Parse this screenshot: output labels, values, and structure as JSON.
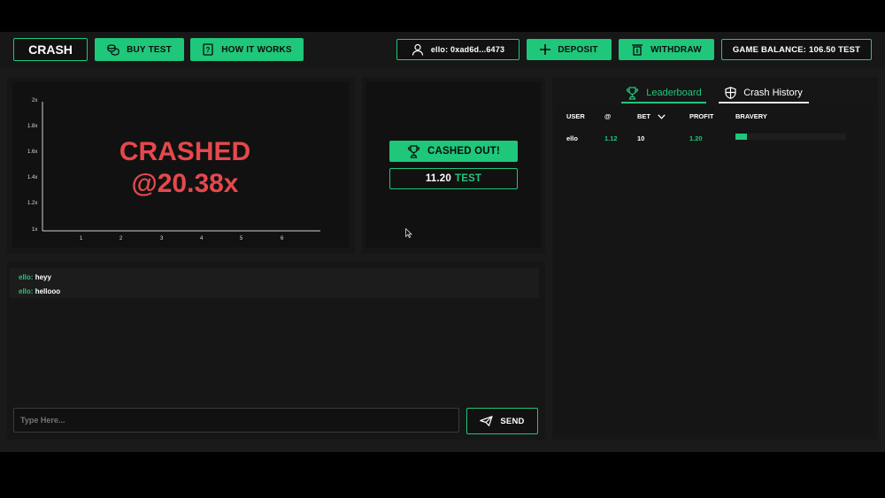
{
  "header": {
    "logo": "CRASH",
    "buy_label": "BUY TEST",
    "how_label": "HOW IT WORKS",
    "account_label": "ello: 0xad6d...6473",
    "deposit_label": "DEPOSIT",
    "withdraw_label": "WITHDRAW",
    "balance_label": "GAME BALANCE: 106.50 TEST"
  },
  "game": {
    "status_line1": "CRASHED",
    "status_line2": "@20.38x",
    "y_ticks": [
      "2x",
      "1.8x",
      "1.6x",
      "1.4x",
      "1.2x",
      "1x"
    ],
    "x_ticks": [
      "1",
      "2",
      "3",
      "4",
      "5",
      "6"
    ]
  },
  "bet": {
    "cashed_out_label": "CASHED OUT!",
    "amount": "11.20",
    "currency": "TEST"
  },
  "chat": {
    "messages": [
      {
        "user": "ello:",
        "text": "heyy"
      },
      {
        "user": "ello:",
        "text": "hellooo"
      }
    ],
    "input_placeholder": "Type Here...",
    "send_label": "SEND"
  },
  "leaderboard": {
    "tabs": [
      {
        "label": "Leaderboard",
        "active": true
      },
      {
        "label": "Crash History",
        "active": false
      }
    ],
    "columns": [
      "USER",
      "@",
      "BET",
      "PROFIT",
      "BRAVERY"
    ],
    "rows": [
      {
        "user": "ello",
        "at": "1.12",
        "bet": "10",
        "profit": "1.20",
        "bravery": 0.1
      }
    ]
  },
  "colors": {
    "accent": "#1fc77a",
    "crash_red": "#e5484d",
    "background": "#1a1a1a"
  }
}
